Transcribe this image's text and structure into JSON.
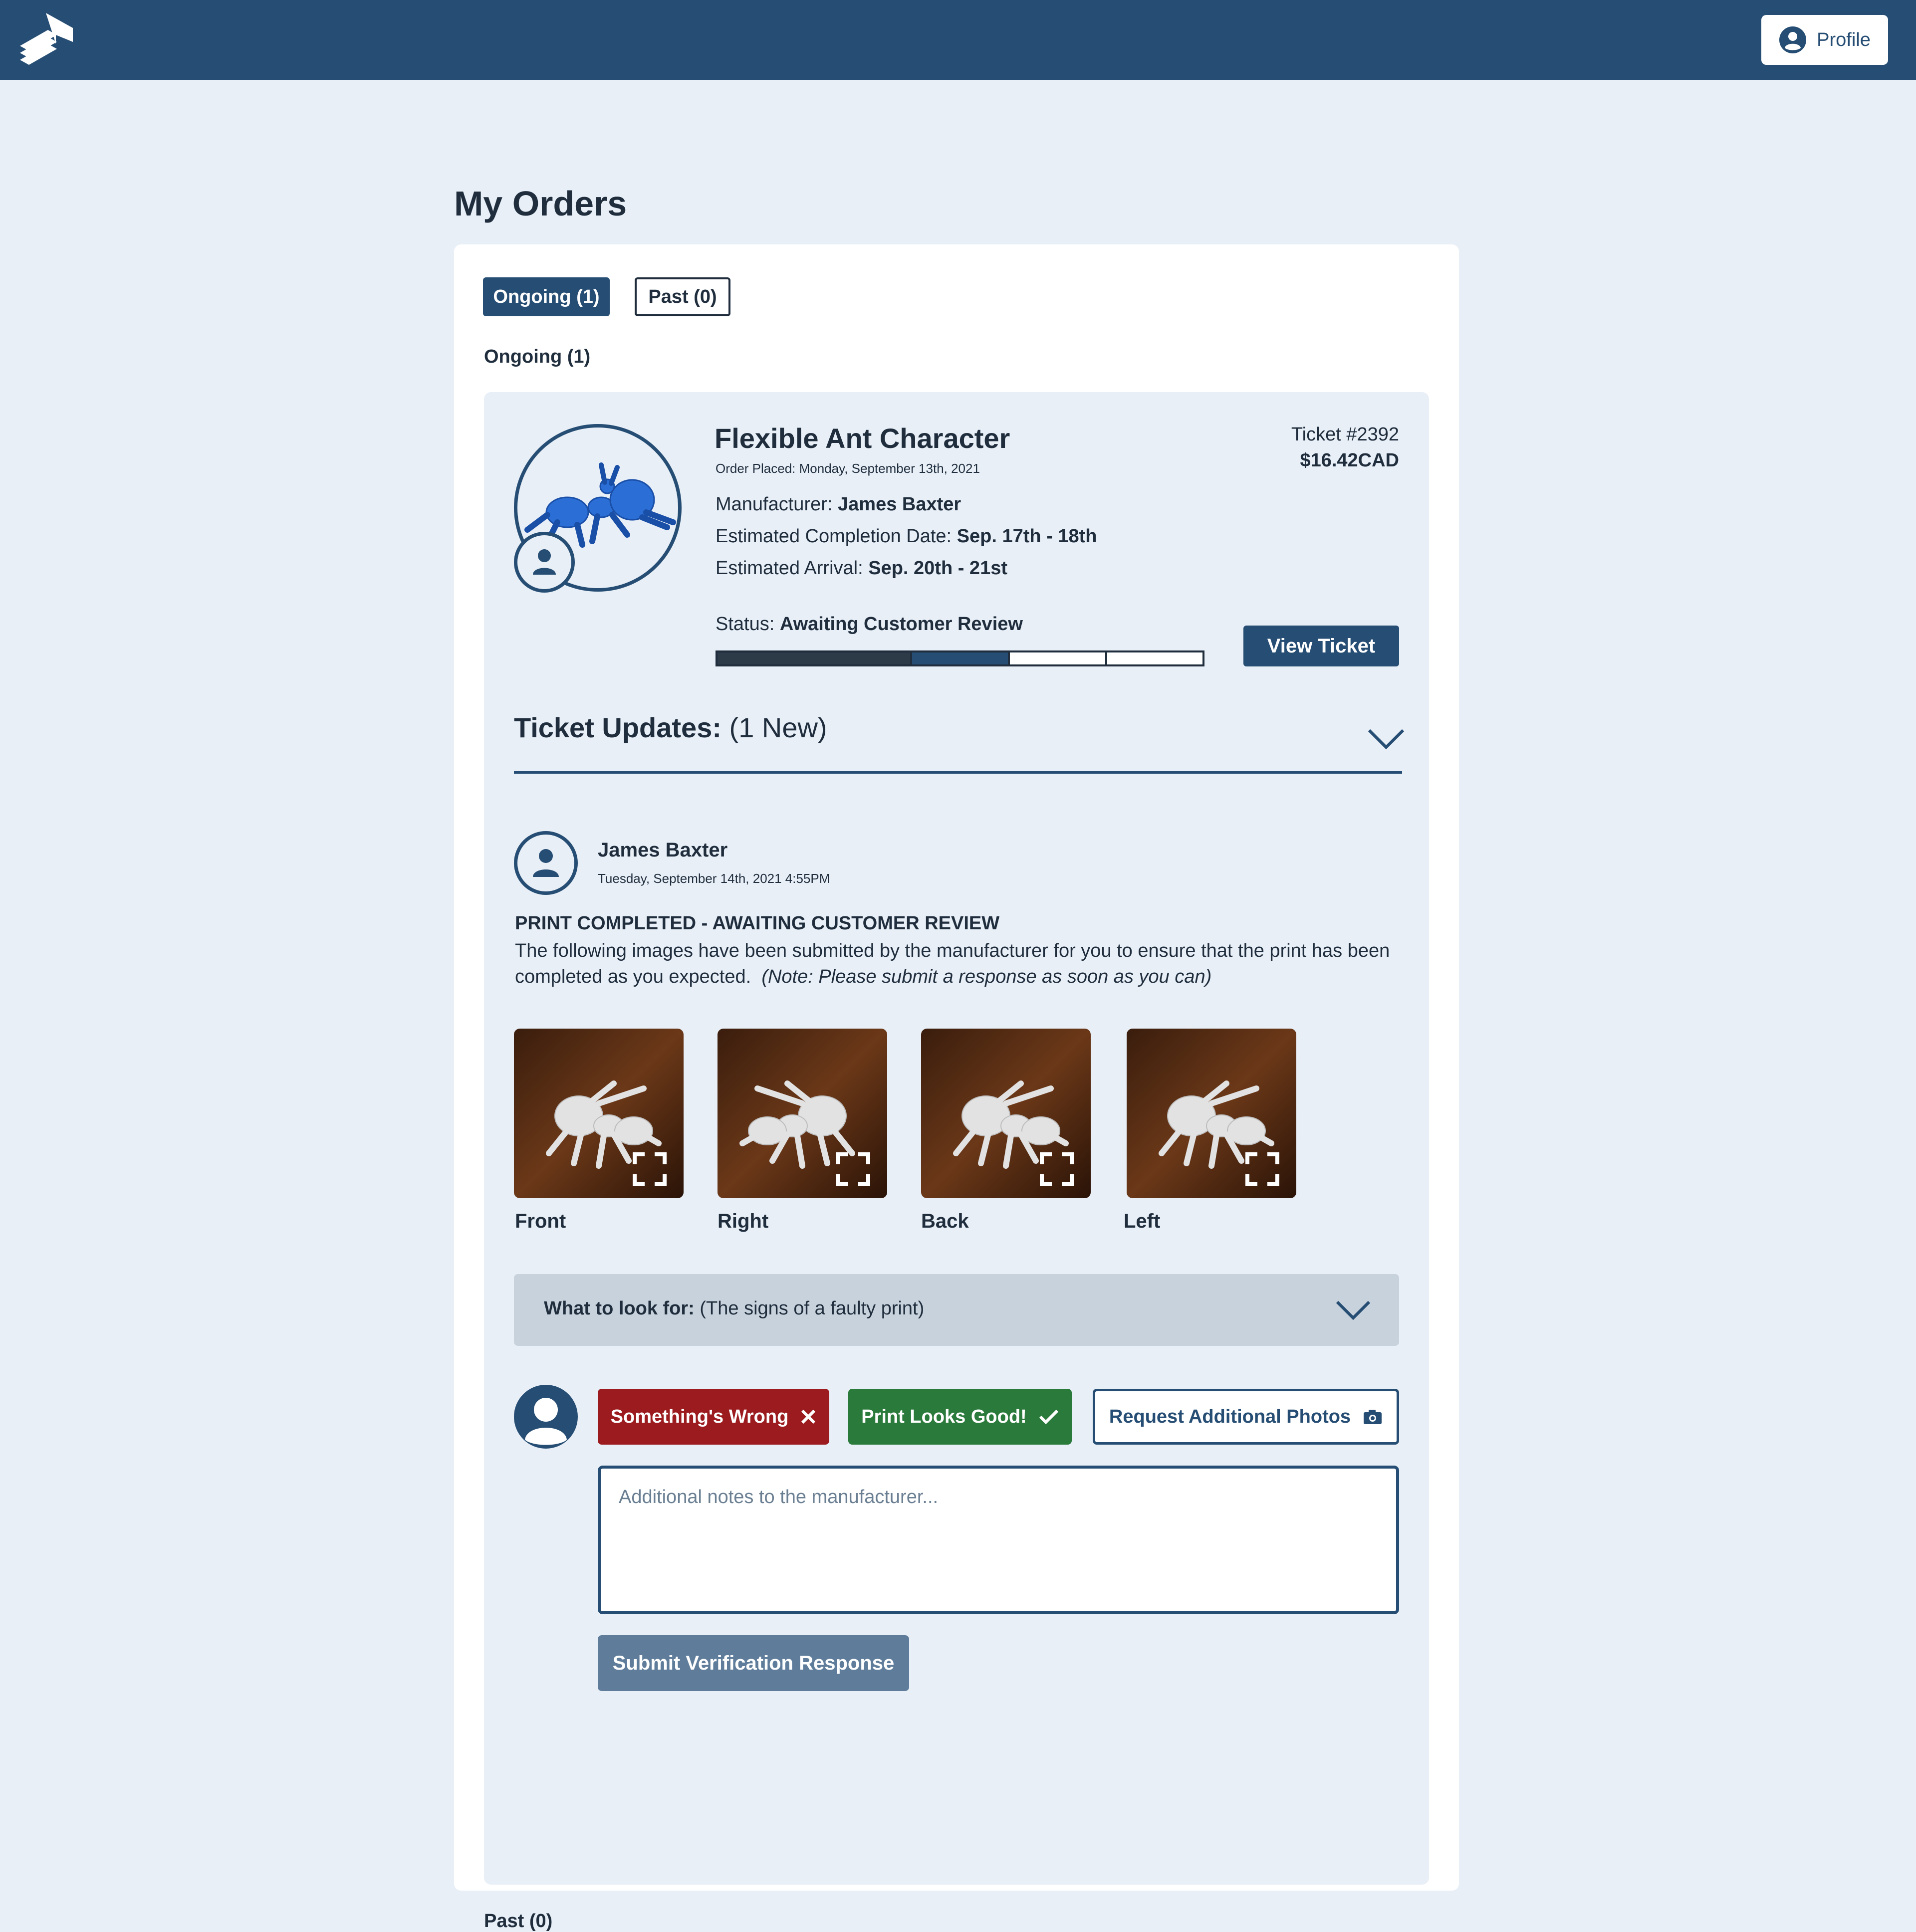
{
  "header": {
    "logo_icon": "stacked-layers-logo-icon",
    "profile_label": "Profile",
    "profile_icon": "user-circle-icon"
  },
  "page": {
    "title": "My Orders"
  },
  "tabs": [
    {
      "label": "Ongoing (1)",
      "active": true
    },
    {
      "label": "Past (0)",
      "active": false
    }
  ],
  "sections": {
    "ongoing_label": "Ongoing (1)",
    "past_label": "Past (0)"
  },
  "order": {
    "title": "Flexible Ant Character",
    "order_placed": "Order Placed: Monday, September 13th, 2021",
    "ticket": "Ticket #2392",
    "price": "$16.42CAD",
    "manufacturer_label": "Manufacturer:",
    "manufacturer": "James Baxter",
    "completion_label": "Estimated Completion Date:",
    "completion": "Sep. 17th - 18th",
    "arrival_label": "Estimated Arrival:",
    "arrival": "Sep. 20th - 21st",
    "status_label": "Status:",
    "status": "Awaiting Customer Review",
    "progress_steps_total": 5,
    "progress_steps_done": 2,
    "progress_step_current": 3,
    "view_ticket_label": "View Ticket"
  },
  "updates": {
    "title": "Ticket Updates:",
    "count": "(1 New)",
    "message": {
      "author": "James Baxter",
      "date": "Tuesday, September 14th, 2021 4:55PM",
      "heading": "PRINT COMPLETED - AWAITING CUSTOMER REVIEW",
      "body": "The following images have been submitted by the manufacturer for you to ensure that the print has been completed as you expected.",
      "note": "(Note: Please submit a response as soon as you can)"
    },
    "photos": [
      {
        "label": "Front"
      },
      {
        "label": "Right"
      },
      {
        "label": "Back"
      },
      {
        "label": "Left"
      }
    ],
    "look_for_label": "What to look for:",
    "look_for_hint": "(The signs of a faulty print)"
  },
  "response": {
    "wrong_label": "Something's Wrong",
    "good_label": "Print Looks Good!",
    "photos_label": "Request Additional Photos",
    "notes_placeholder": "Additional notes to the manufacturer...",
    "notes_value": "",
    "submit_label": "Submit Verification Response"
  },
  "colors": {
    "brand": "#264d73",
    "background": "#e8eff7",
    "danger": "#9b1b1e",
    "success": "#2a7a3b",
    "progress_done": "#2d3a48",
    "progress_current": "#264d73",
    "submit_disabled": "#5f7d9b"
  }
}
